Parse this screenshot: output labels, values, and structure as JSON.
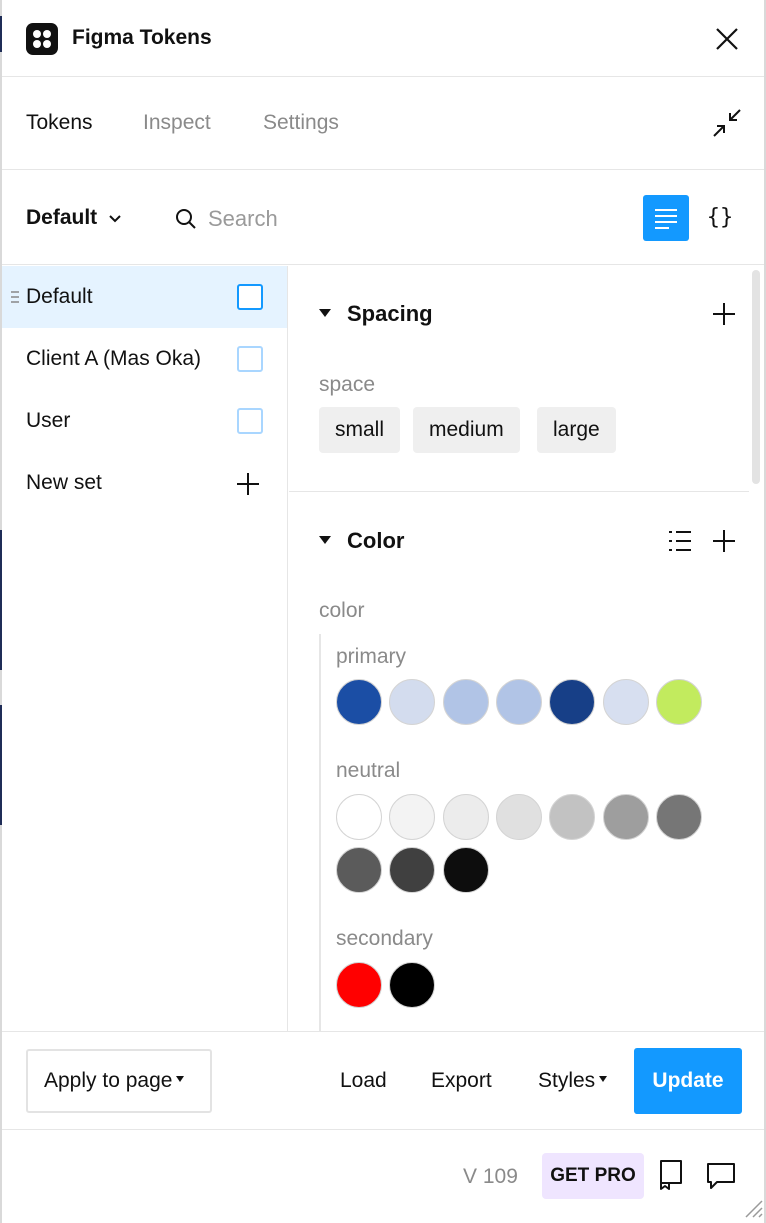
{
  "app": {
    "title": "Figma Tokens"
  },
  "tabs": [
    {
      "label": "Tokens",
      "active": true
    },
    {
      "label": "Inspect",
      "active": false
    },
    {
      "label": "Settings",
      "active": false
    }
  ],
  "toolbar": {
    "theme": "Default",
    "search_placeholder": "Search"
  },
  "token_sets": [
    {
      "label": "Default",
      "active": true
    },
    {
      "label": "Client A (Mas Oka)",
      "active": false
    },
    {
      "label": "User",
      "active": false
    }
  ],
  "new_set_label": "New set",
  "spacing": {
    "title": "Spacing",
    "group": "space",
    "chips": [
      "small",
      "medium",
      "large"
    ]
  },
  "color": {
    "title": "Color",
    "group": "color",
    "subgroups": [
      {
        "label": "primary",
        "swatches": [
          "#1b4ea5",
          "#d3dcee",
          "#b1c4e6",
          "#b1c4e6",
          "#173f87",
          "#d7dff0",
          "#c2eb5e"
        ]
      },
      {
        "label": "neutral",
        "swatches": [
          "#ffffff",
          "#f3f3f3",
          "#ececec",
          "#e0e0e0",
          "#c2c2c2",
          "#9e9e9e",
          "#767676",
          "#5b5b5b",
          "#404040",
          "#0d0d0d"
        ]
      },
      {
        "label": "secondary",
        "swatches": [
          "#ff0000",
          "#000000"
        ]
      }
    ]
  },
  "footer": {
    "apply_label": "Apply to page",
    "load_label": "Load",
    "export_label": "Export",
    "styles_label": "Styles",
    "update_label": "Update"
  },
  "status": {
    "version": "V 109",
    "get_pro": "GET PRO"
  },
  "colors": {
    "accent": "#1399ff",
    "pro_bg": "#efe5ff",
    "active_row": "#e5f3ff"
  }
}
